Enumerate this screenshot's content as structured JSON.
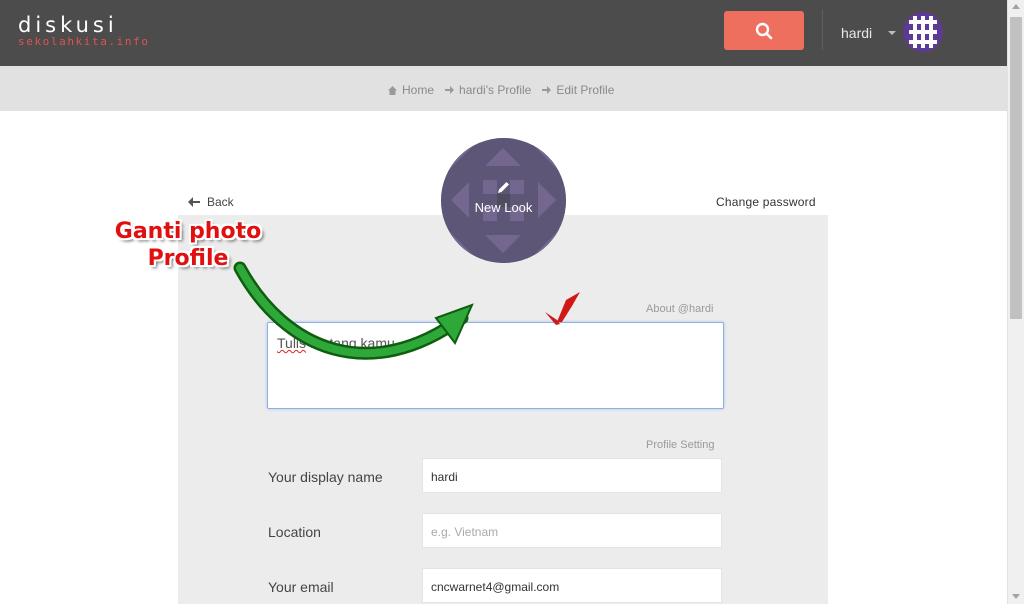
{
  "header": {
    "logo_main": "diskusi",
    "logo_sub": "sekolahkita.info",
    "search_icon": "search-icon",
    "username": "hardi",
    "accent_color": "#ef6f5e"
  },
  "breadcrumb": {
    "items": [
      {
        "label": "Home",
        "icon": "home-icon"
      },
      {
        "label": "hardi's Profile",
        "icon": "arrow-right-icon"
      },
      {
        "label": "Edit Profile",
        "icon": "arrow-right-icon"
      }
    ]
  },
  "profile": {
    "back_label": "Back",
    "change_password_label": "Change password",
    "avatar_overlay_label": "New Look",
    "about_label": "About @hardi",
    "about_value": "Tulis tentang kamu",
    "about_spell_word": "Tulis",
    "about_rest": " tentang kamu",
    "section_label": "Profile Setting",
    "fields": [
      {
        "label": "Your display name",
        "value": "hardi",
        "placeholder": ""
      },
      {
        "label": "Location",
        "value": "",
        "placeholder": "e.g. Vietnam"
      },
      {
        "label": "Your email",
        "value": "cncwarnet4@gmail.com",
        "placeholder": ""
      }
    ]
  },
  "annotation": {
    "line1": "Ganti photo",
    "line2": "Profile"
  }
}
